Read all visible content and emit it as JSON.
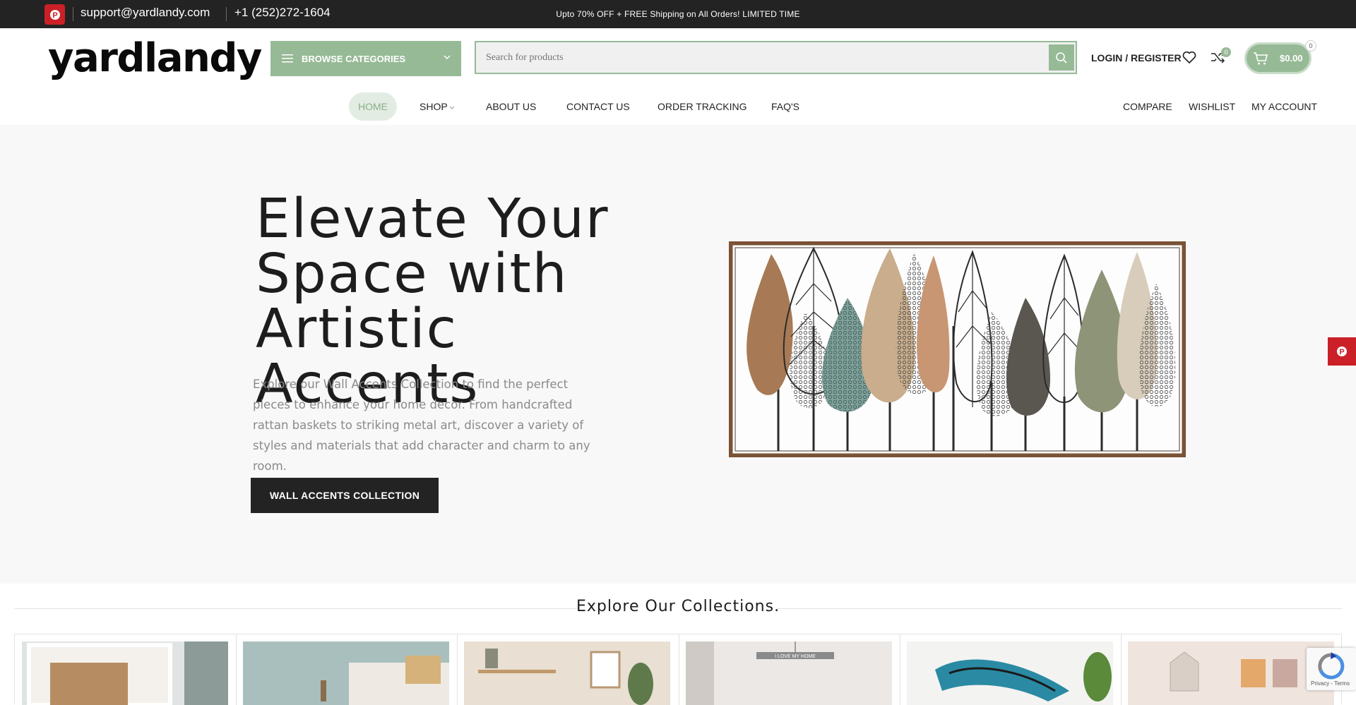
{
  "topbar": {
    "email": "support@yardlandy.com",
    "phone": "+1 (252)272-1604",
    "promo": "Upto 70% OFF + FREE Shipping on All Orders! LIMITED TIME",
    "social_icon": "pinterest-icon"
  },
  "header": {
    "logo": "yardlandy",
    "browse_label": "BROWSE CATEGORIES",
    "search_placeholder": "Search for products",
    "login_label": "LOGIN / REGISTER",
    "compare_count": "0",
    "cart_total": "$0.00",
    "cart_count": "0",
    "accent_color": "#97ba96"
  },
  "nav": {
    "main": [
      "HOME",
      "SHOP",
      "ABOUT US",
      "CONTACT US",
      "ORDER TRACKING",
      "FAQ'S"
    ],
    "secondary": [
      "COMPARE",
      "WISHLIST",
      "MY ACCOUNT"
    ]
  },
  "hero": {
    "headline": "Elevate Your Space with Artistic Accents",
    "description": "Explore our Wall Accents Collection to find the perfect pieces to enhance your home decor. From handcrafted rattan baskets to striking metal art, discover a variety of styles and materials that add character and charm to any room.",
    "cta_label": "WALL ACCENTS COLLECTION"
  },
  "collections": {
    "title": "Explore Our Collections."
  },
  "recaptcha": {
    "text": "Privacy - Terms"
  }
}
